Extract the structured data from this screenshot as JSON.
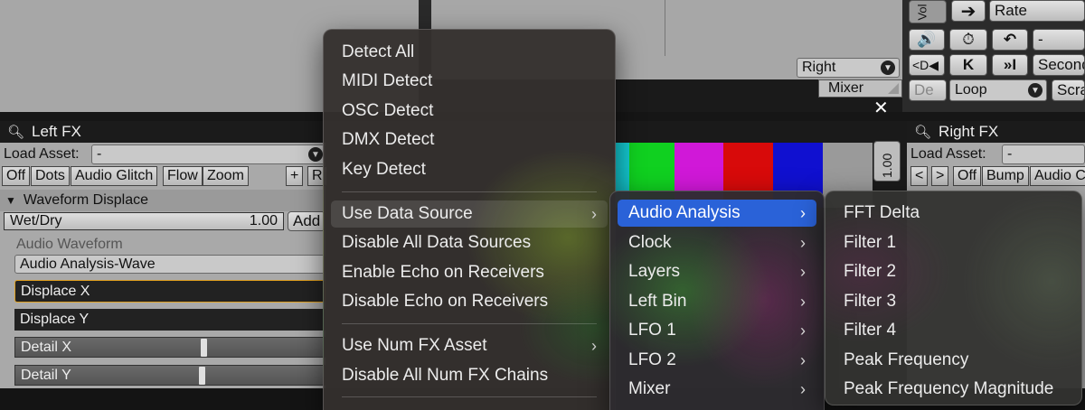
{
  "top": {
    "right_select": "Right",
    "mixer_label": "Mixer",
    "vol_label": "Vol",
    "rate_label": "Rate",
    "rate_value": "-",
    "second_label": "Second",
    "loop_select": "Loop",
    "scratch_label": "Scra",
    "de_label": "De"
  },
  "left_fx": {
    "title": "Left FX",
    "load_asset_label": "Load Asset:",
    "load_asset_value": "-",
    "tabs": [
      "Off",
      "Dots",
      "Audio Glitch",
      "Flow",
      "Zoom"
    ],
    "plus": "+",
    "r_tab": "R",
    "section_title": "Waveform Displace",
    "wet_dry_label": "Wet/Dry",
    "wet_dry_value": "1.00",
    "add_label": "Add",
    "audio_waveform_label": "Audio Waveform",
    "audio_waveform_value": "Audio Analysis-Wave",
    "displace_x": "Displace X",
    "displace_y": "Displace Y",
    "detail_x": "Detail X",
    "detail_y": "Detail Y"
  },
  "center": {
    "close": "✕",
    "level_value": "1.00"
  },
  "right_fx": {
    "title": "Right FX",
    "load_asset_label": "Load Asset:",
    "load_asset_value": "-",
    "prev": "<",
    "next": ">",
    "tabs": [
      "Off",
      "Bump",
      "Audio C"
    ]
  },
  "menu1": {
    "items_top": [
      "Detect All",
      "MIDI Detect",
      "OSC Detect",
      "DMX Detect",
      "Key Detect"
    ],
    "items_mid": [
      "Use Data Source",
      "Disable All Data Sources",
      "Enable Echo on Receivers",
      "Disable Echo on Receivers"
    ],
    "items_bottom": [
      "Use Num FX Asset",
      "Disable All Num FX Chains"
    ],
    "chevron": "›"
  },
  "menu2": {
    "items": [
      "Audio Analysis",
      "Clock",
      "Layers",
      "Left Bin",
      "LFO 1",
      "LFO 2",
      "Mixer"
    ]
  },
  "menu3": {
    "items": [
      "FFT Delta",
      "Filter 1",
      "Filter 2",
      "Filter 3",
      "Filter 4",
      "Peak Frequency",
      "Peak Frequency Magnitude"
    ]
  },
  "colors": {
    "accent_selected": "#2a62d8",
    "displace_x_border": "#e0a020",
    "color_bars": [
      "#14c8d0",
      "#10d020",
      "#d018d8",
      "#d80a0a",
      "#1010d0"
    ]
  }
}
